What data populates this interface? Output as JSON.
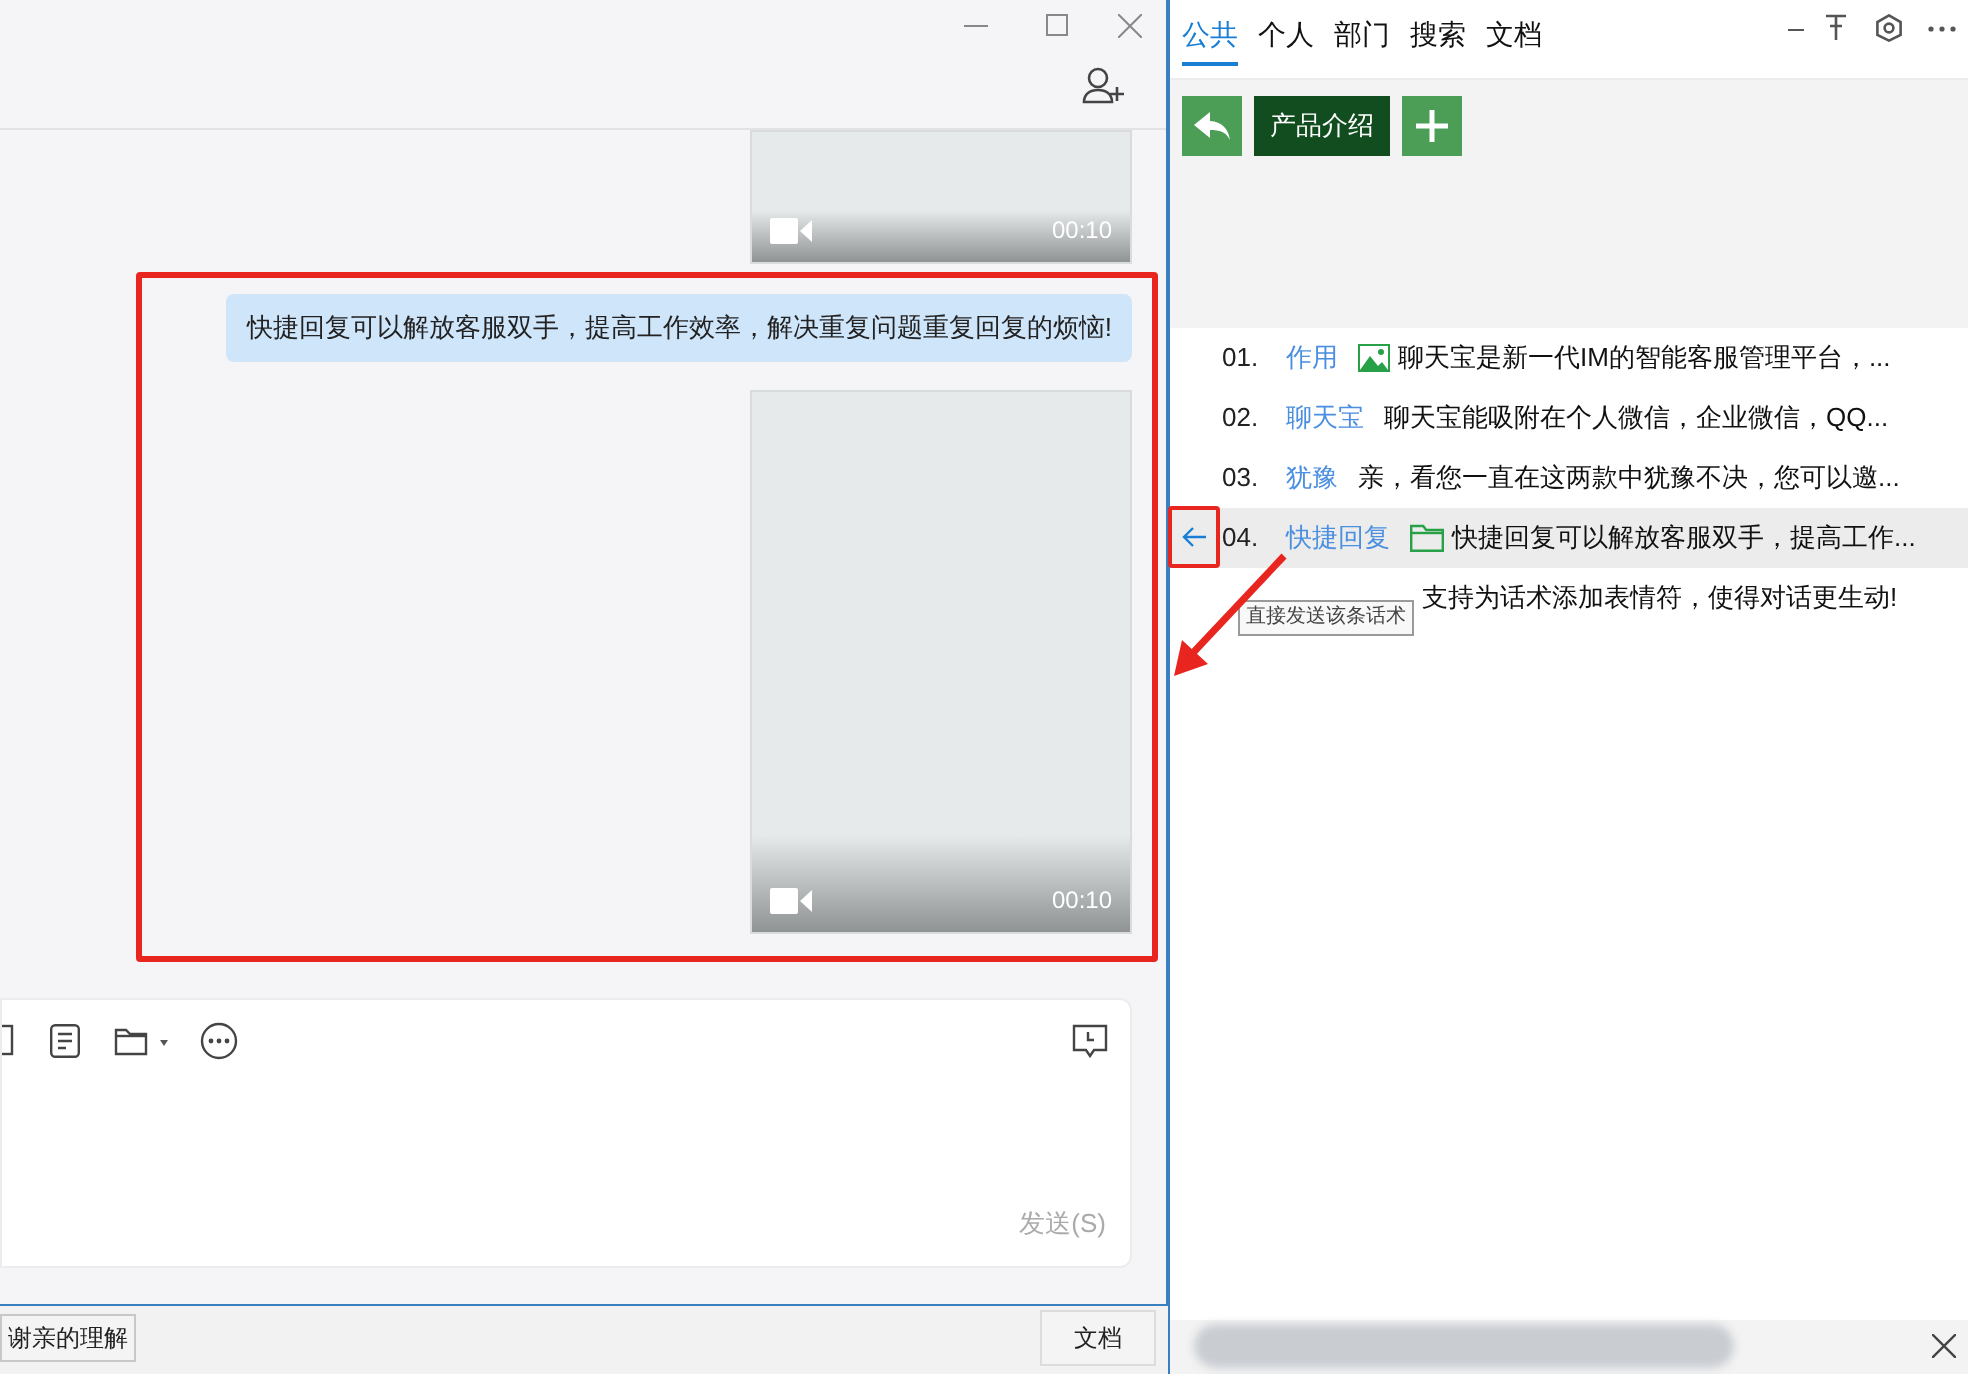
{
  "chat": {
    "messages": [
      {
        "kind": "video",
        "duration": "00:10",
        "cut": true
      },
      {
        "kind": "text",
        "text": "快捷回复可以解放客服双手，提高工作效率，解决重复问题重复回复的烦恼!"
      },
      {
        "kind": "video",
        "duration": "00:10",
        "cut": false
      }
    ],
    "send_button": "发送(S)"
  },
  "bottom_bar": {
    "left_button": "谢亲的理解",
    "right_button": "文档"
  },
  "panel": {
    "tabs": [
      {
        "label": "公共",
        "selected": true
      },
      {
        "label": "个人",
        "selected": false
      },
      {
        "label": "部门",
        "selected": false
      },
      {
        "label": "搜索",
        "selected": false
      },
      {
        "label": "文档",
        "selected": false
      }
    ],
    "folder_button": "产品介绍",
    "scripts": [
      {
        "number": "01.",
        "category": "作用",
        "image_attached": true,
        "text": "聊天宝是新一代IM的智能客服管理平台，...",
        "selected": false
      },
      {
        "number": "02.",
        "category": "聊天宝",
        "text": "聊天宝能吸附在个人微信，企业微信，QQ...",
        "selected": false
      },
      {
        "number": "03.",
        "category": "犹豫",
        "text": "亲，看您一直在这两款中犹豫不决，您可以邀...",
        "selected": false
      },
      {
        "number": "04.",
        "category": "快捷回复",
        "folder_attached": true,
        "text": "快捷回复可以解放客服双手，提高工作...",
        "selected": true
      },
      {
        "text": "支持为话术添加表情符，使得对话更生动!",
        "selected": false
      }
    ],
    "tooltip": "直接发送该条话术"
  }
}
